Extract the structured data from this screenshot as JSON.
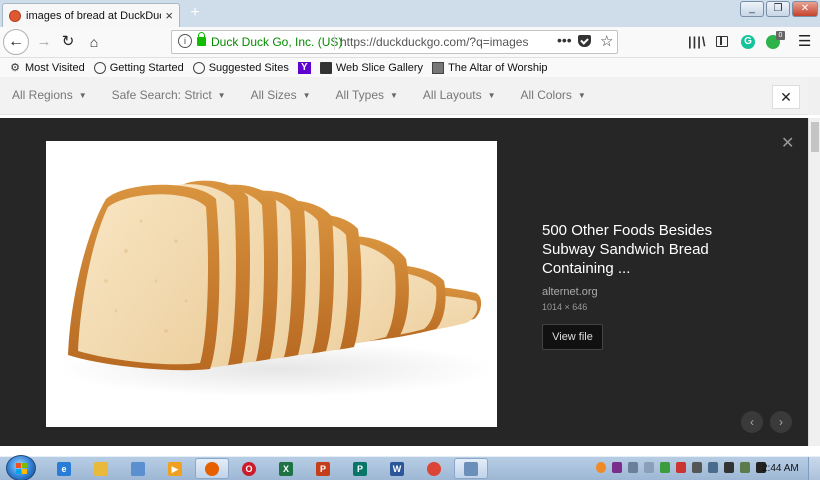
{
  "window": {
    "minimize_icon": "minimize-icon",
    "restore_icon": "restore-icon",
    "close_icon": "close-icon"
  },
  "tab": {
    "title": "images of bread at DuckDuckG",
    "close": "×",
    "new_tab": "+"
  },
  "nav": {
    "back": "←",
    "forward": "→",
    "reload": "↻",
    "home": "⌂"
  },
  "urlbar": {
    "info": "i",
    "identity": "Duck Duck Go, Inc. (US)",
    "url": "https://duckduckgo.com/?q=images",
    "more": "•••",
    "star": "☆"
  },
  "toolbar": {
    "library": "|||\\",
    "grammarly": "G",
    "ext_badge": "0",
    "menu": "☰"
  },
  "bookmarks": [
    {
      "label": "Most Visited",
      "icon": "gear-icon"
    },
    {
      "label": "Getting Started",
      "icon": "globe-icon"
    },
    {
      "label": "Suggested Sites",
      "icon": "globe-icon"
    },
    {
      "label": "",
      "icon": "yahoo-icon"
    },
    {
      "label": "Web Slice Gallery",
      "icon": "web-slice-icon"
    },
    {
      "label": "The Altar of Worship",
      "icon": "page-icon"
    }
  ],
  "filters": [
    {
      "label": "All Regions"
    },
    {
      "label": "Safe Search: Strict"
    },
    {
      "label": "All Sizes"
    },
    {
      "label": "All Types"
    },
    {
      "label": "All Layouts"
    },
    {
      "label": "All Colors"
    }
  ],
  "filter_close": "✕",
  "detail": {
    "close": "✕",
    "title": "500 Other Foods Besides Subway Sandwich Bread Containing ...",
    "source": "alternet.org",
    "dimensions": "1014 × 646",
    "view_file": "View file",
    "prev": "‹",
    "next": "›"
  },
  "taskbar": {
    "clock": "2:44 AM",
    "apps": [
      {
        "name": "internet-explorer",
        "color": "#2a7dd6",
        "glyph": "e"
      },
      {
        "name": "file-explorer",
        "color": "#e8b93b",
        "glyph": ""
      },
      {
        "name": "paint",
        "color": "#5a8fd0",
        "glyph": ""
      },
      {
        "name": "media-player",
        "color": "#f0a020",
        "glyph": "▶"
      },
      {
        "name": "firefox",
        "color": "#e66000",
        "glyph": ""
      },
      {
        "name": "opera",
        "color": "#cc1b2b",
        "glyph": "O"
      },
      {
        "name": "excel",
        "color": "#1f7244",
        "glyph": "X"
      },
      {
        "name": "powerpoint",
        "color": "#c43e1c",
        "glyph": "P"
      },
      {
        "name": "publisher",
        "color": "#077568",
        "glyph": "P"
      },
      {
        "name": "word",
        "color": "#2b579a",
        "glyph": "W"
      },
      {
        "name": "chrome",
        "color": "#db4437",
        "glyph": ""
      },
      {
        "name": "network-drive",
        "color": "#6a8fb8",
        "glyph": ""
      }
    ]
  }
}
